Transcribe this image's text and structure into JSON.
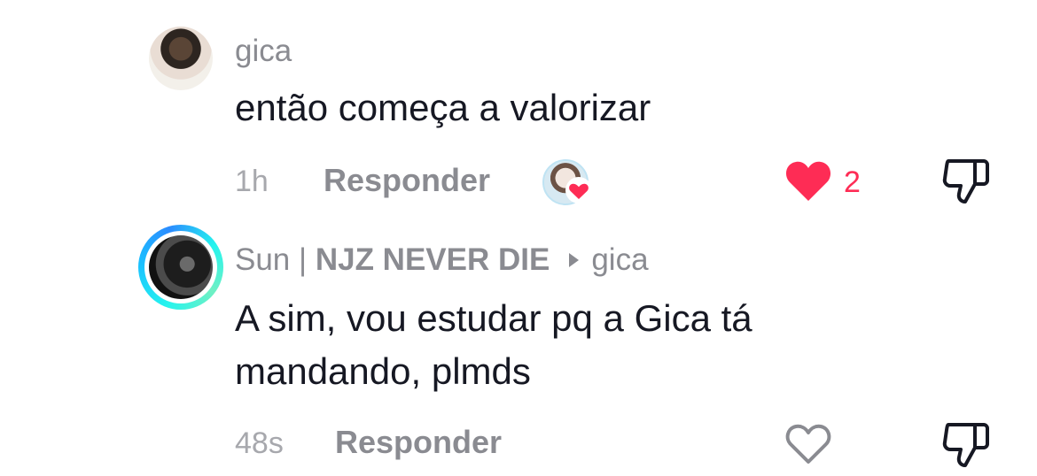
{
  "comments": [
    {
      "username": "gica",
      "text": "então começa a valorizar",
      "time": "1h",
      "reply_label": "Responder",
      "likes": "2",
      "liked": true,
      "icons": [
        "avatar",
        "creator-liked-heart",
        "heart-filled-icon",
        "dislike-icon"
      ]
    },
    {
      "username_plain": "Sun | ",
      "username_bold": "NJZ NEVER DIE",
      "reply_to": "gica",
      "text_line1": "A sim, vou estudar pq a Gica tá",
      "text_line2": "mandando, plmds",
      "time": "48s",
      "reply_label": "Responder",
      "liked": false,
      "icons": [
        "avatar-with-story-ring",
        "reply-arrow-icon",
        "heart-outline-icon",
        "dislike-icon"
      ]
    }
  ],
  "colors": {
    "accent": "#fe2c55",
    "text": "#161823",
    "muted": "#8a8b91",
    "story_ring": "#25f4ee"
  }
}
